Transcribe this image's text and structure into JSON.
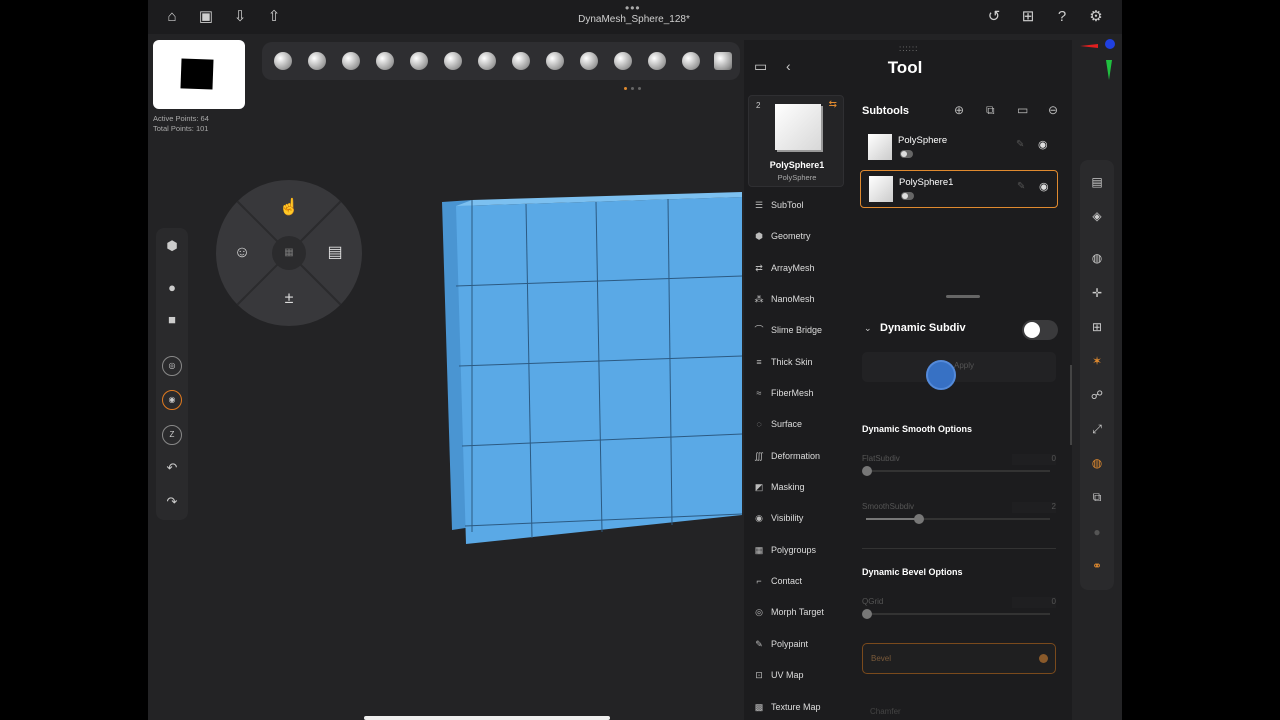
{
  "app": {
    "title": "DynaMesh_Sphere_128*",
    "top_dots": "•••"
  },
  "topbar": {
    "left_icons": [
      "home-icon",
      "save-icon",
      "import-icon",
      "share-icon"
    ],
    "right_icons": [
      "history-icon",
      "layout-icon",
      "help-icon",
      "gear-icon"
    ]
  },
  "stats": {
    "active_points": "Active Points: 64",
    "total_points": "Total Points: 101"
  },
  "panel": {
    "title": "Tool",
    "grip": "::::::"
  },
  "tool_card": {
    "count": "2",
    "name": "PolySphere1",
    "sub": "PolySphere"
  },
  "menu": [
    {
      "label": "SubTool",
      "icon": "subtool-icon"
    },
    {
      "label": "Geometry",
      "icon": "geometry-icon"
    },
    {
      "label": "ArrayMesh",
      "icon": "arraymesh-icon"
    },
    {
      "label": "NanoMesh",
      "icon": "nanomesh-icon"
    },
    {
      "label": "Slime Bridge",
      "icon": "slime-bridge-icon"
    },
    {
      "label": "Thick Skin",
      "icon": "thick-skin-icon"
    },
    {
      "label": "FiberMesh",
      "icon": "fibermesh-icon"
    },
    {
      "label": "Surface",
      "icon": "surface-icon"
    },
    {
      "label": "Deformation",
      "icon": "deformation-icon"
    },
    {
      "label": "Masking",
      "icon": "masking-icon"
    },
    {
      "label": "Visibility",
      "icon": "visibility-icon"
    },
    {
      "label": "Polygroups",
      "icon": "polygroups-icon"
    },
    {
      "label": "Contact",
      "icon": "contact-icon"
    },
    {
      "label": "Morph Target",
      "icon": "morph-target-icon"
    },
    {
      "label": "Polypaint",
      "icon": "polypaint-icon"
    },
    {
      "label": "UV Map",
      "icon": "uv-map-icon"
    },
    {
      "label": "Texture Map",
      "icon": "texture-map-icon"
    }
  ],
  "subtools": {
    "header": "Subtools",
    "items": [
      {
        "name": "PolySphere",
        "selected": false
      },
      {
        "name": "PolySphere1",
        "selected": true
      }
    ]
  },
  "geometry": {
    "dynamic_subdiv": "Dynamic Subdiv",
    "apply": "Apply",
    "smooth_options": "Dynamic Smooth Options",
    "flat_subdiv": {
      "label": "FlatSubdiv",
      "value": "0"
    },
    "smooth_subdiv": {
      "label": "SmoothSubdiv",
      "value": "2"
    },
    "bevel_options": "Dynamic Bevel Options",
    "qgrid": {
      "label": "QGrid",
      "value": "0"
    },
    "bevel": "Bevel",
    "chamfer": "Chamfer"
  },
  "colors": {
    "mesh": "#5aa9e6",
    "accent": "#e08a2f",
    "panel_bg": "#1c1c1e",
    "viewport_bg": "#232325"
  }
}
